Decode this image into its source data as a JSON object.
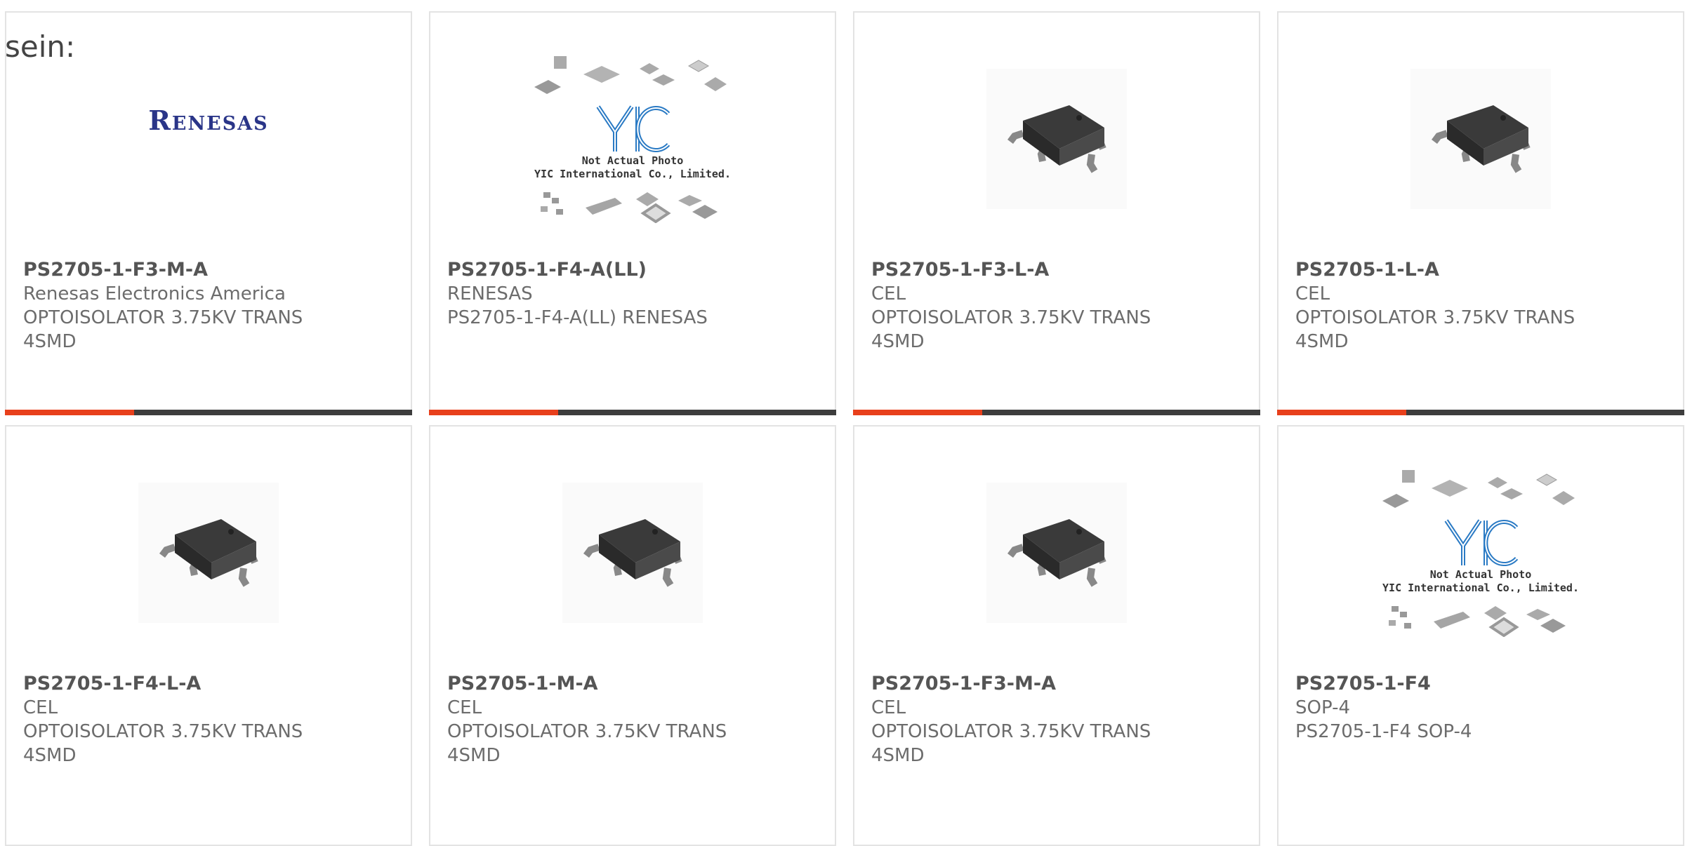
{
  "intro_text": "sein:",
  "colors": {
    "accent": "#e8401c",
    "bar_dark": "#3d3d3d",
    "border": "#e3e3e3",
    "text": "#666666"
  },
  "placeholder": {
    "logo_text": "YIC",
    "caption_line1": "Not Actual Photo",
    "caption_line2": "YIC International Co., Limited."
  },
  "products": [
    {
      "part": "PS2705-1-F3-M-A",
      "maker": "Renesas Electronics America",
      "desc1": "OPTOISOLATOR 3.75KV TRANS",
      "desc2": "4SMD",
      "image": "renesas-logo",
      "logo_text": "Renesas"
    },
    {
      "part": "PS2705-1-F4-A(LL)",
      "maker": "RENESAS",
      "desc1": "PS2705-1-F4-A(LL) RENESAS",
      "desc2": "",
      "image": "yic-placeholder"
    },
    {
      "part": "PS2705-1-F3-L-A",
      "maker": "CEL",
      "desc1": "OPTOISOLATOR 3.75KV TRANS",
      "desc2": "4SMD",
      "image": "optoisolator-photo"
    },
    {
      "part": "PS2705-1-L-A",
      "maker": "CEL",
      "desc1": "OPTOISOLATOR 3.75KV TRANS",
      "desc2": "4SMD",
      "image": "optoisolator-photo"
    },
    {
      "part": "PS2705-1-F4-L-A",
      "maker": "CEL",
      "desc1": "OPTOISOLATOR 3.75KV TRANS",
      "desc2": "4SMD",
      "image": "optoisolator-photo"
    },
    {
      "part": "PS2705-1-M-A",
      "maker": "CEL",
      "desc1": "OPTOISOLATOR 3.75KV TRANS",
      "desc2": "4SMD",
      "image": "optoisolator-photo"
    },
    {
      "part": "PS2705-1-F3-M-A",
      "maker": "CEL",
      "desc1": "OPTOISOLATOR 3.75KV TRANS",
      "desc2": "4SMD",
      "image": "optoisolator-photo"
    },
    {
      "part": "PS2705-1-F4",
      "maker": "SOP-4",
      "desc1": "PS2705-1-F4 SOP-4",
      "desc2": "",
      "image": "yic-placeholder"
    }
  ]
}
